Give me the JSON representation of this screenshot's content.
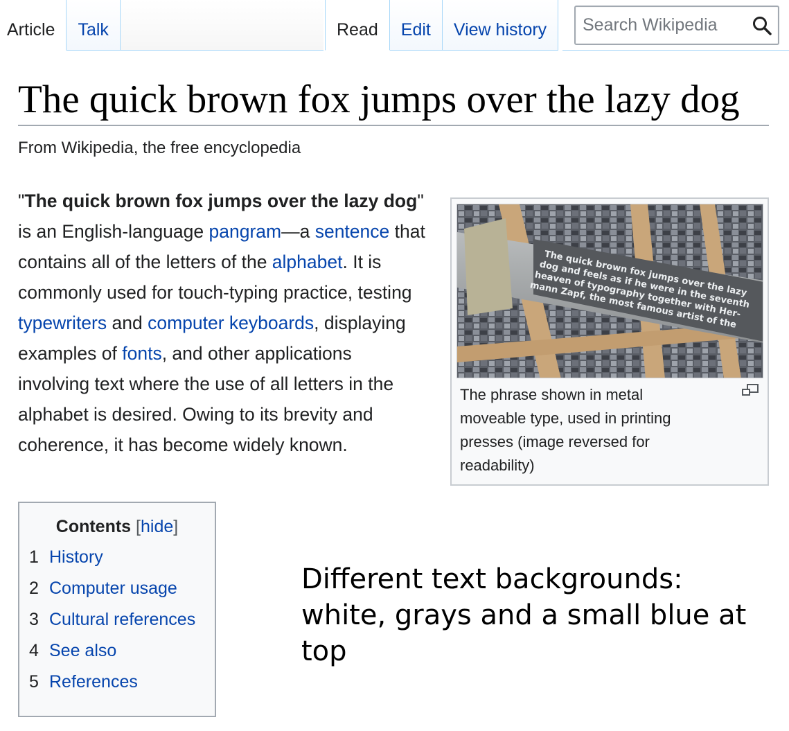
{
  "tabs": {
    "article": "Article",
    "talk": "Talk",
    "read": "Read",
    "edit": "Edit",
    "history": "View history"
  },
  "search": {
    "placeholder": "Search Wikipedia"
  },
  "page": {
    "title": "The quick brown fox jumps over the lazy dog",
    "subtitle": "From Wikipedia, the free encyclopedia"
  },
  "lead": {
    "quote_open": "\"",
    "bold": "The quick brown fox jumps over the lazy dog",
    "t1": "\" is an English-language ",
    "l_pangram": "pangram",
    "t2": "—a ",
    "l_sentence": "sentence",
    "t3": " that contains all of the letters of the ",
    "l_alphabet": "alphabet",
    "t4": ". It is commonly used for touch-typing practice, testing ",
    "l_typewriters": "typewriters",
    "t5": " and ",
    "l_keyboards": "computer keyboards",
    "t6": ", displaying examples of ",
    "l_fonts": "fonts",
    "t7": ", and other applications involving text where the use of all letters in the alphabet is desired. Owing to its brevity and coherence, it has become widely known."
  },
  "thumb": {
    "caption": "The phrase shown in metal moveable type, used in printing presses (image reversed for readability)",
    "image_text": "The quick brown fox jumps over the lazy dog and feels as if he were in the seventh heaven of typography together with Hermann Zapf, the most famous artist of the"
  },
  "toc": {
    "title": "Contents",
    "bracket_open": "[",
    "hide": "hide",
    "bracket_close": "]",
    "items": [
      {
        "num": "1",
        "label": "History"
      },
      {
        "num": "2",
        "label": "Computer usage"
      },
      {
        "num": "3",
        "label": "Cultural references"
      },
      {
        "num": "4",
        "label": "See also"
      },
      {
        "num": "5",
        "label": "References"
      }
    ]
  },
  "note": "Different text backgrounds: white, grays and a small blue at top",
  "colors": {
    "link": "#0645ad",
    "tab_border": "#a7d7f9",
    "box_border": "#a2a9b1",
    "box_bg": "#f8f9fa"
  },
  "icons": {
    "search": "magnifier-icon",
    "magnify": "enlarge-icon"
  }
}
